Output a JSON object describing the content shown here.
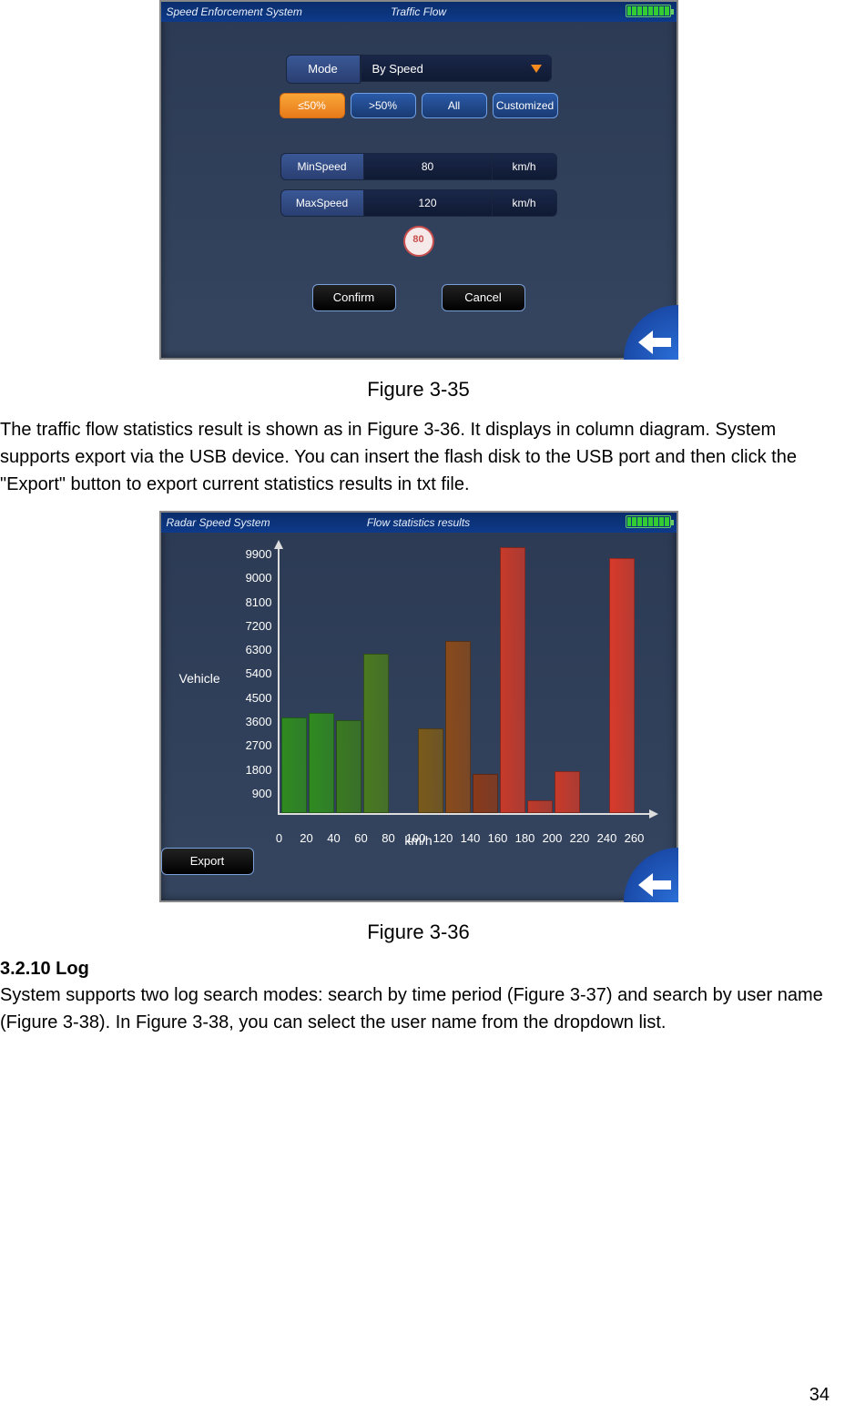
{
  "screen1": {
    "app_title": "Speed Enforcement System",
    "page_title": "Traffic Flow",
    "mode_label": "Mode",
    "mode_value": "By Speed",
    "filters": [
      "≤50%",
      ">50%",
      "All",
      "Customized"
    ],
    "min_label": "MinSpeed",
    "min_value": "80",
    "min_unit": "km/h",
    "max_label": "MaxSpeed",
    "max_value": "120",
    "max_unit": "km/h",
    "badge": "80",
    "confirm": "Confirm",
    "cancel": "Cancel"
  },
  "caption1": "Figure 3-35",
  "para1": "The traffic flow statistics result is shown as in Figure 3-36. It displays in column diagram. System supports export via the USB device. You can insert the flash disk to the USB port and then click the \"Export\" button to export current statistics results in txt file.",
  "screen2": {
    "app_title": "Radar Speed System",
    "page_title": "Flow statistics results",
    "ylabel": "Vehicle",
    "xlabel": "km/h",
    "export": "Export"
  },
  "caption2": "Figure 3-36",
  "section_number": "3.2.10",
  "section_title": "Log",
  "para2": "System supports two log search modes: search by time period (Figure 3-37) and search by user name (Figure 3-38). In Figure 3-38, you can select the user name from the dropdown list.",
  "page_number": "34",
  "chart_data": {
    "type": "bar",
    "title": "Flow statistics results",
    "xlabel": "km/h",
    "ylabel": "Vehicle",
    "ylim": [
      0,
      9900
    ],
    "y_ticks": [
      900,
      1800,
      2700,
      3600,
      4500,
      5400,
      6300,
      7200,
      8100,
      9000,
      9900
    ],
    "categories": [
      0,
      20,
      40,
      60,
      80,
      100,
      120,
      140,
      160,
      180,
      200,
      220,
      240,
      260
    ],
    "series": [
      {
        "name": "vehicles",
        "values": [
          3500,
          3700,
          3400,
          5900,
          null,
          3100,
          6400,
          1400,
          9900,
          400,
          1500,
          null,
          9500
        ]
      }
    ],
    "bar_colors": [
      "#2f8b1f",
      "#2f8b1f",
      "#3a7a1f",
      "#4a7a1f",
      null,
      "#7a5a1a",
      "#8a4a1a",
      "#8a3a1a",
      "#c83a2a",
      "#be3a2a",
      "#c83a2a",
      null,
      "#d83a2a"
    ]
  }
}
